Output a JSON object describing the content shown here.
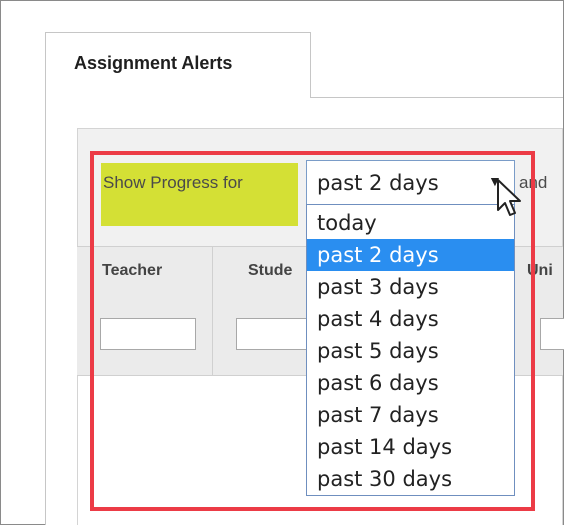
{
  "tab": {
    "label": "Assignment Alerts"
  },
  "filter": {
    "label": "Show Progress for",
    "selected_value": "past 2 days",
    "trailing_text": "and",
    "options": [
      "today",
      "past 2 days",
      "past 3 days",
      "past 4 days",
      "past 5 days",
      "past 6 days",
      "past 7 days",
      "past 14 days",
      "past 30 days"
    ]
  },
  "table": {
    "columns": [
      "Teacher",
      "Stude",
      "Uni"
    ]
  },
  "colors": {
    "highlight": "#d4e035",
    "annotation_border": "#ec3b46",
    "selected_option": "#2a8ef0"
  },
  "icons": {
    "select_arrow": "chevron-down-icon",
    "cursor": "mouse-pointer-icon"
  }
}
